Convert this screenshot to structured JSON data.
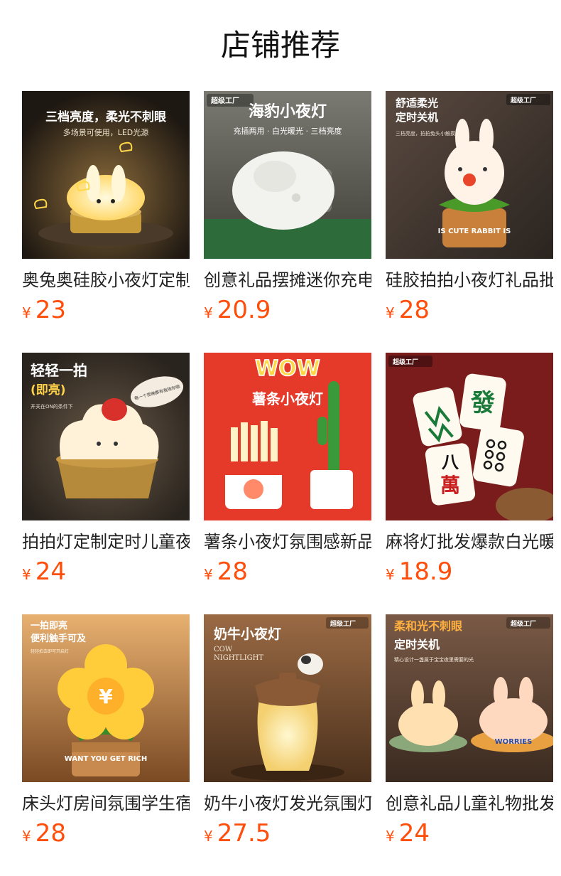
{
  "header": {
    "title": "店铺推荐"
  },
  "currency": "¥",
  "products": [
    {
      "name": "奥兔奥硅胶小夜灯定制款",
      "price": "23",
      "image": {
        "icon": "bunny-lamp-image",
        "caption": "三档亮度，柔光不刺眼",
        "sub": "多场景可使用，LED光源",
        "bg": "#3a2f25"
      }
    },
    {
      "name": "创意礼品摆摊迷你充电夜灯",
      "price": "20.9",
      "image": {
        "icon": "seal-lamp-image",
        "badge": "超级工厂",
        "caption": "海豹小夜灯",
        "sub": "充插两用 · 白光暖光 · 三档亮度",
        "bg": "#5c5c55"
      }
    },
    {
      "name": "硅胶拍拍小夜灯礼品批发",
      "price": "28",
      "image": {
        "icon": "rabbit-pot-lamp-image",
        "badge": "超级工厂",
        "caption": "舒适柔光",
        "caption2": "定时关机",
        "sub": "三档亮度，拍拍兔头小触摸",
        "pot_text": "IS CUTE RABBIT IS",
        "bg": "#3d3530"
      }
    },
    {
      "name": "拍拍灯定制定时儿童夜灯",
      "price": "24",
      "image": {
        "icon": "cupcake-lamp-image",
        "caption": "轻轻一拍",
        "caption2": "(即亮)",
        "sub": "开关在ON的条件下",
        "bubble": "每一个夜晚都有我陪你哦",
        "bg": "#3b342c"
      }
    },
    {
      "name": "薯条小夜灯氛围感新品",
      "price": "28",
      "image": {
        "icon": "fries-lamp-image",
        "wow": "WOW",
        "caption": "薯条小夜灯",
        "bg": "#e8392a"
      }
    },
    {
      "name": "麻将灯批发爆款白光暖光",
      "price": "18.9",
      "image": {
        "icon": "mahjong-lamp-image",
        "badge": "超级工厂",
        "tile1": "發",
        "tile2": "八",
        "tile3": "萬",
        "bg": "#7a1c1c"
      }
    },
    {
      "name": "床头灯房间氛围学生宿舍",
      "price": "28",
      "image": {
        "icon": "flower-lamp-image",
        "caption": "一拍即亮",
        "caption2": "便利触手可及",
        "sub": "轻轻拍击即可开启灯",
        "coin": "¥",
        "pot_text": "WANT YOU GET RICH",
        "bg": "#c98a4f"
      }
    },
    {
      "name": "奶牛小夜灯发光氛围灯",
      "price": "27.5",
      "image": {
        "icon": "cow-lamp-image",
        "badge": "超级工厂",
        "caption": "奶牛小夜灯",
        "sub": "COW",
        "sub2": "NIGHTLIGHT",
        "bg": "#7a5236"
      }
    },
    {
      "name": "创意礼品儿童礼物批发",
      "price": "24",
      "image": {
        "icon": "ufo-bunny-lamp-image",
        "badge": "超级工厂",
        "caption": "柔和光不刺眼",
        "caption2": "定时关机",
        "sub": "精心设计一盏属于宝宝夜里需要的光",
        "pot_text": "WORRIES",
        "bg": "#6a4a38"
      }
    }
  ]
}
